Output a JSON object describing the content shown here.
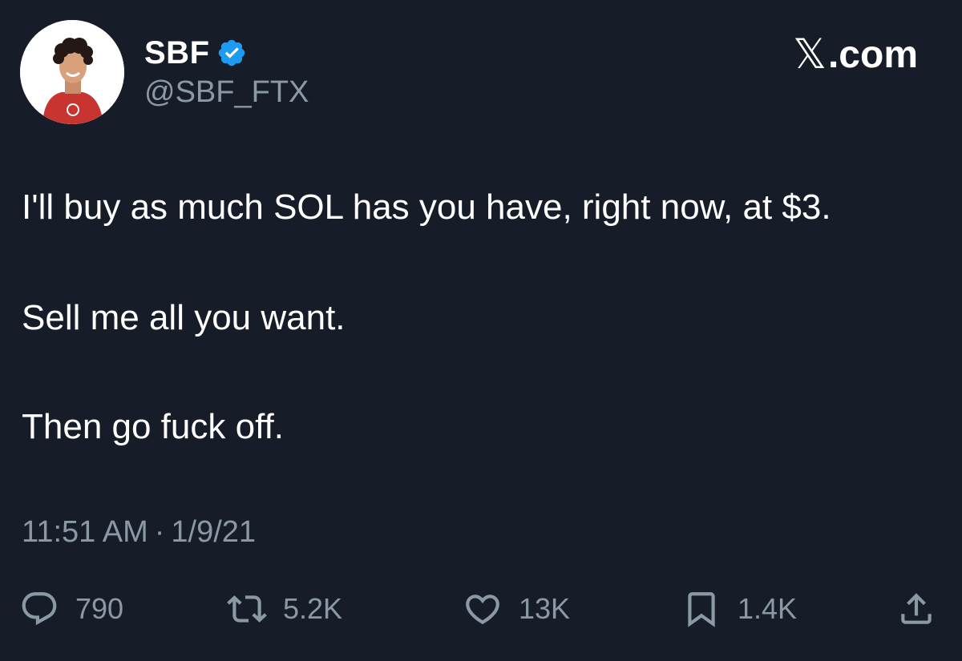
{
  "author": {
    "display_name": "SBF",
    "handle": "@SBF_FTX",
    "verified": true
  },
  "brand": {
    "x_glyph": "𝕏",
    "suffix": ".com"
  },
  "tweet": {
    "lines": [
      "I'll buy as much SOL has you have, right now, at $3.",
      "Sell me all you want.",
      "Then go fuck off."
    ]
  },
  "meta": {
    "time": "11:51 AM",
    "separator": "·",
    "date": "1/9/21"
  },
  "actions": {
    "reply": {
      "icon": "reply-icon",
      "count": "790"
    },
    "retweet": {
      "icon": "retweet-icon",
      "count": "5.2K"
    },
    "like": {
      "icon": "heart-icon",
      "count": "13K"
    },
    "bookmark": {
      "icon": "bookmark-icon",
      "count": "1.4K"
    },
    "share": {
      "icon": "share-icon"
    }
  },
  "colors": {
    "background": "#161d28",
    "text": "#ffffff",
    "muted": "#8b98a5",
    "verified": "#1d9bf0"
  }
}
